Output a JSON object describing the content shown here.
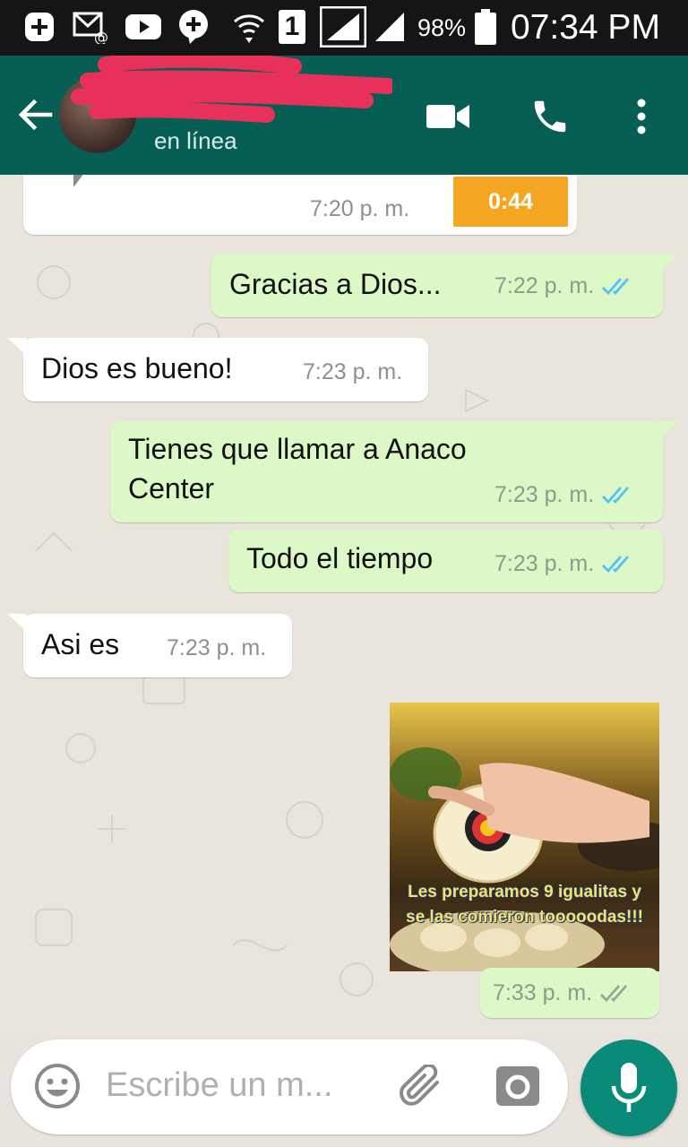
{
  "status_bar": {
    "sim_slot": "1",
    "battery": "98%",
    "time": "07:34 PM"
  },
  "header": {
    "contact_name": "Da",
    "contact_status": "en línea"
  },
  "messages": [
    {
      "direction": "in",
      "type": "audio",
      "duration": "0:44",
      "time": "7:20 p. m."
    },
    {
      "direction": "out",
      "text": "Gracias a Dios...",
      "time": "7:22 p. m.",
      "status": "read"
    },
    {
      "direction": "in",
      "text": "Dios es bueno!",
      "time": "7:23 p. m."
    },
    {
      "direction": "out",
      "text_line1": "Tienes que llamar a Anaco",
      "text_line2": "Center",
      "time": "7:23 p. m.",
      "status": "read"
    },
    {
      "direction": "out",
      "text": "Todo el tiempo",
      "time": "7:23 p. m.",
      "status": "read"
    },
    {
      "direction": "in",
      "text": "Asi es",
      "time": "7:23 p. m."
    },
    {
      "direction": "out",
      "type": "image",
      "caption_line1": "Les preparamos 9 igualitas y",
      "caption_line2": "se las comieron tooooodas!!!",
      "time": "7:33 p. m.",
      "status": "delivered"
    }
  ],
  "composer": {
    "placeholder": "Escribe un m..."
  },
  "colors": {
    "header": "#075e54",
    "outgoing_bubble": "#dcf8c6",
    "incoming_bubble": "#ffffff",
    "read_ticks": "#4fc3f7",
    "audio_duration_badge": "#f5a623",
    "mic_button": "#0a8a79"
  },
  "icons": [
    "plus-circle-icon",
    "email-icon",
    "youtube-icon",
    "chat-plus-icon",
    "wifi-icon",
    "signal-icon",
    "battery-icon",
    "back-arrow-icon",
    "video-call-icon",
    "phone-icon",
    "more-vert-icon",
    "double-check-icon",
    "emoji-icon",
    "attach-icon",
    "camera-icon",
    "mic-icon"
  ]
}
